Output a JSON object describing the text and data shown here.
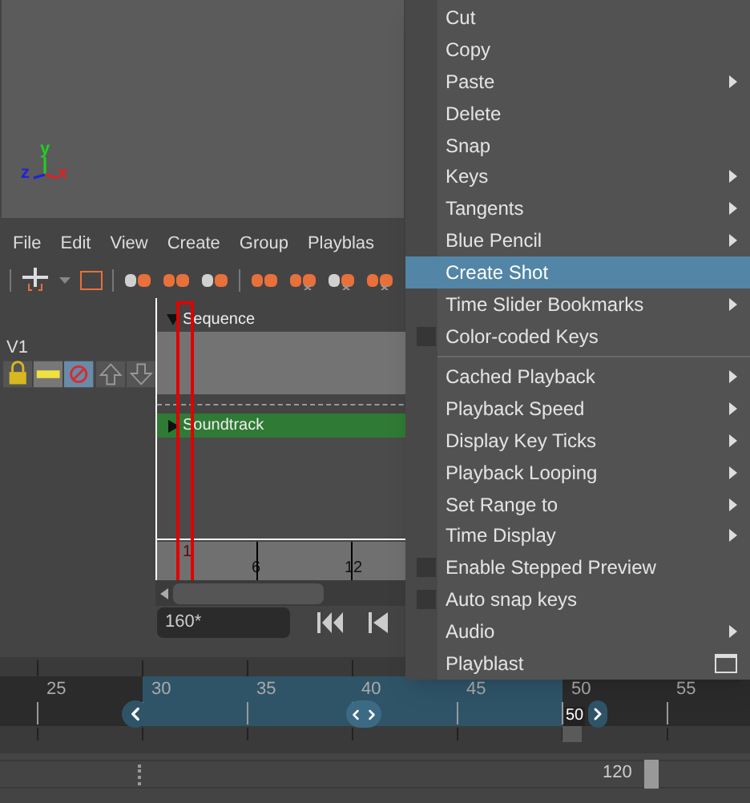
{
  "viewport": {
    "axes": [
      "x",
      "y",
      "z"
    ]
  },
  "menu_bar": [
    "File",
    "Edit",
    "View",
    "Create",
    "Group",
    "Playblas"
  ],
  "track_header": {
    "label": "V1"
  },
  "tracks": [
    {
      "label": "Sequence",
      "expanded": true
    },
    {
      "label": "Soundtrack",
      "expanded": false
    }
  ],
  "ruler": {
    "ticks": [
      "1",
      "6",
      "12"
    ]
  },
  "frame_field": {
    "value": "160*"
  },
  "time_slider": {
    "ticks": [
      "25",
      "30",
      "35",
      "40",
      "45",
      "50",
      "55"
    ],
    "current_frame": "50",
    "level": 0.75
  },
  "range_slider": {
    "end": "120",
    "level": 0.86
  },
  "context_menu": {
    "items": [
      {
        "kind": "item",
        "label": "Cut",
        "submenu": false,
        "option_box": false,
        "selected": false
      },
      {
        "kind": "item",
        "label": "Copy",
        "submenu": false,
        "option_box": false,
        "selected": false
      },
      {
        "kind": "item",
        "label": "Paste",
        "submenu": true,
        "option_box": false,
        "selected": false
      },
      {
        "kind": "item",
        "label": "Delete",
        "submenu": false,
        "option_box": false,
        "selected": false
      },
      {
        "kind": "item",
        "label": "Snap",
        "submenu": false,
        "option_box": false,
        "selected": false
      },
      {
        "kind": "item",
        "label": "Keys",
        "submenu": true,
        "option_box": false,
        "selected": false
      },
      {
        "kind": "item",
        "label": "Tangents",
        "submenu": true,
        "option_box": false,
        "selected": false
      },
      {
        "kind": "item",
        "label": "Blue Pencil",
        "submenu": true,
        "option_box": false,
        "selected": false
      },
      {
        "kind": "item",
        "label": "Create Shot",
        "submenu": false,
        "option_box": false,
        "selected": true
      },
      {
        "kind": "item",
        "label": "Time Slider Bookmarks",
        "submenu": true,
        "option_box": false,
        "selected": false
      },
      {
        "kind": "checkbox",
        "label": "Color-coded Keys",
        "checked": false,
        "submenu": false,
        "option_box": false,
        "selected": false
      },
      {
        "kind": "separator"
      },
      {
        "kind": "item",
        "label": "Cached Playback",
        "submenu": true,
        "option_box": false,
        "selected": false
      },
      {
        "kind": "item",
        "label": "Playback Speed",
        "submenu": true,
        "option_box": false,
        "selected": false
      },
      {
        "kind": "item",
        "label": "Display Key Ticks",
        "submenu": true,
        "option_box": false,
        "selected": false
      },
      {
        "kind": "item",
        "label": "Playback Looping",
        "submenu": true,
        "option_box": false,
        "selected": false
      },
      {
        "kind": "item",
        "label": "Set Range to",
        "submenu": true,
        "option_box": false,
        "selected": false
      },
      {
        "kind": "item",
        "label": "Time Display",
        "submenu": true,
        "option_box": false,
        "selected": false
      },
      {
        "kind": "checkbox",
        "label": "Enable Stepped Preview",
        "checked": false,
        "submenu": false,
        "option_box": false,
        "selected": false
      },
      {
        "kind": "checkbox",
        "label": "Auto snap keys",
        "checked": false,
        "submenu": false,
        "option_box": false,
        "selected": false
      },
      {
        "kind": "item",
        "label": "Audio",
        "submenu": true,
        "option_box": false,
        "selected": false
      },
      {
        "kind": "item",
        "label": "Playblast",
        "submenu": false,
        "option_box": true,
        "selected": false
      }
    ]
  }
}
